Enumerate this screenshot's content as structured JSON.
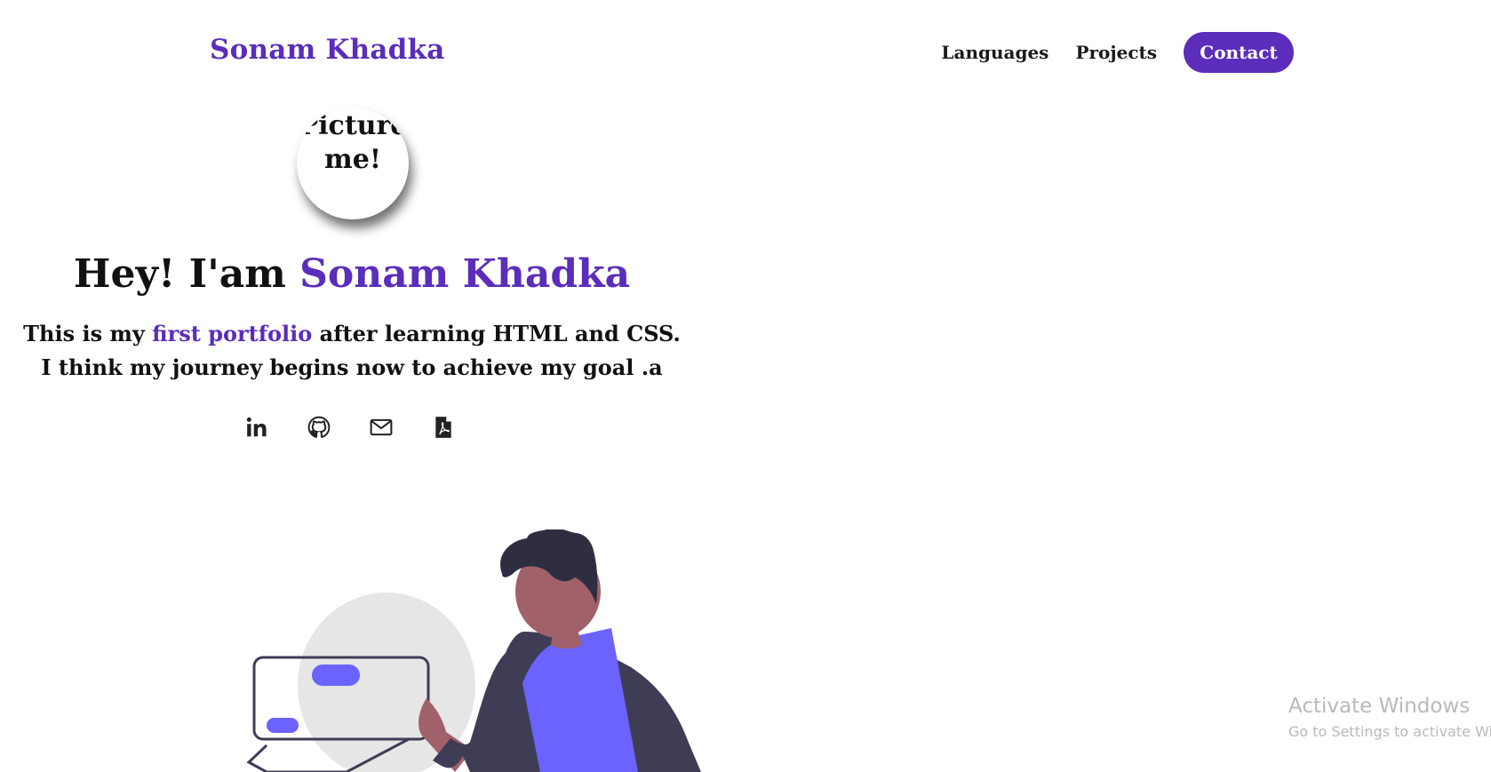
{
  "nav": {
    "brand": "Sonam Khadka",
    "links": [
      "Languages",
      "Projects"
    ],
    "contact_label": "Contact"
  },
  "hero": {
    "avatar_text": "Picture\nme!",
    "greeting": "Hey! I'am ",
    "name": "Sonam Khadka",
    "intro_before": "This is my ",
    "intro_highlight": "first portfolio",
    "intro_after": " after learning HTML and CSS. I think my journey begins now to achieve my goal .a"
  },
  "socials": [
    {
      "name": "linkedin-icon"
    },
    {
      "name": "github-icon"
    },
    {
      "name": "mail-icon"
    },
    {
      "name": "pdf-icon"
    }
  ],
  "watermark": {
    "title": "Activate Windows",
    "subtitle": "Go to Settings to activate Wi"
  },
  "colors": {
    "accent": "#5b2dba",
    "illustration_purple": "#6c63ff",
    "illustration_dark": "#2f2e41"
  }
}
